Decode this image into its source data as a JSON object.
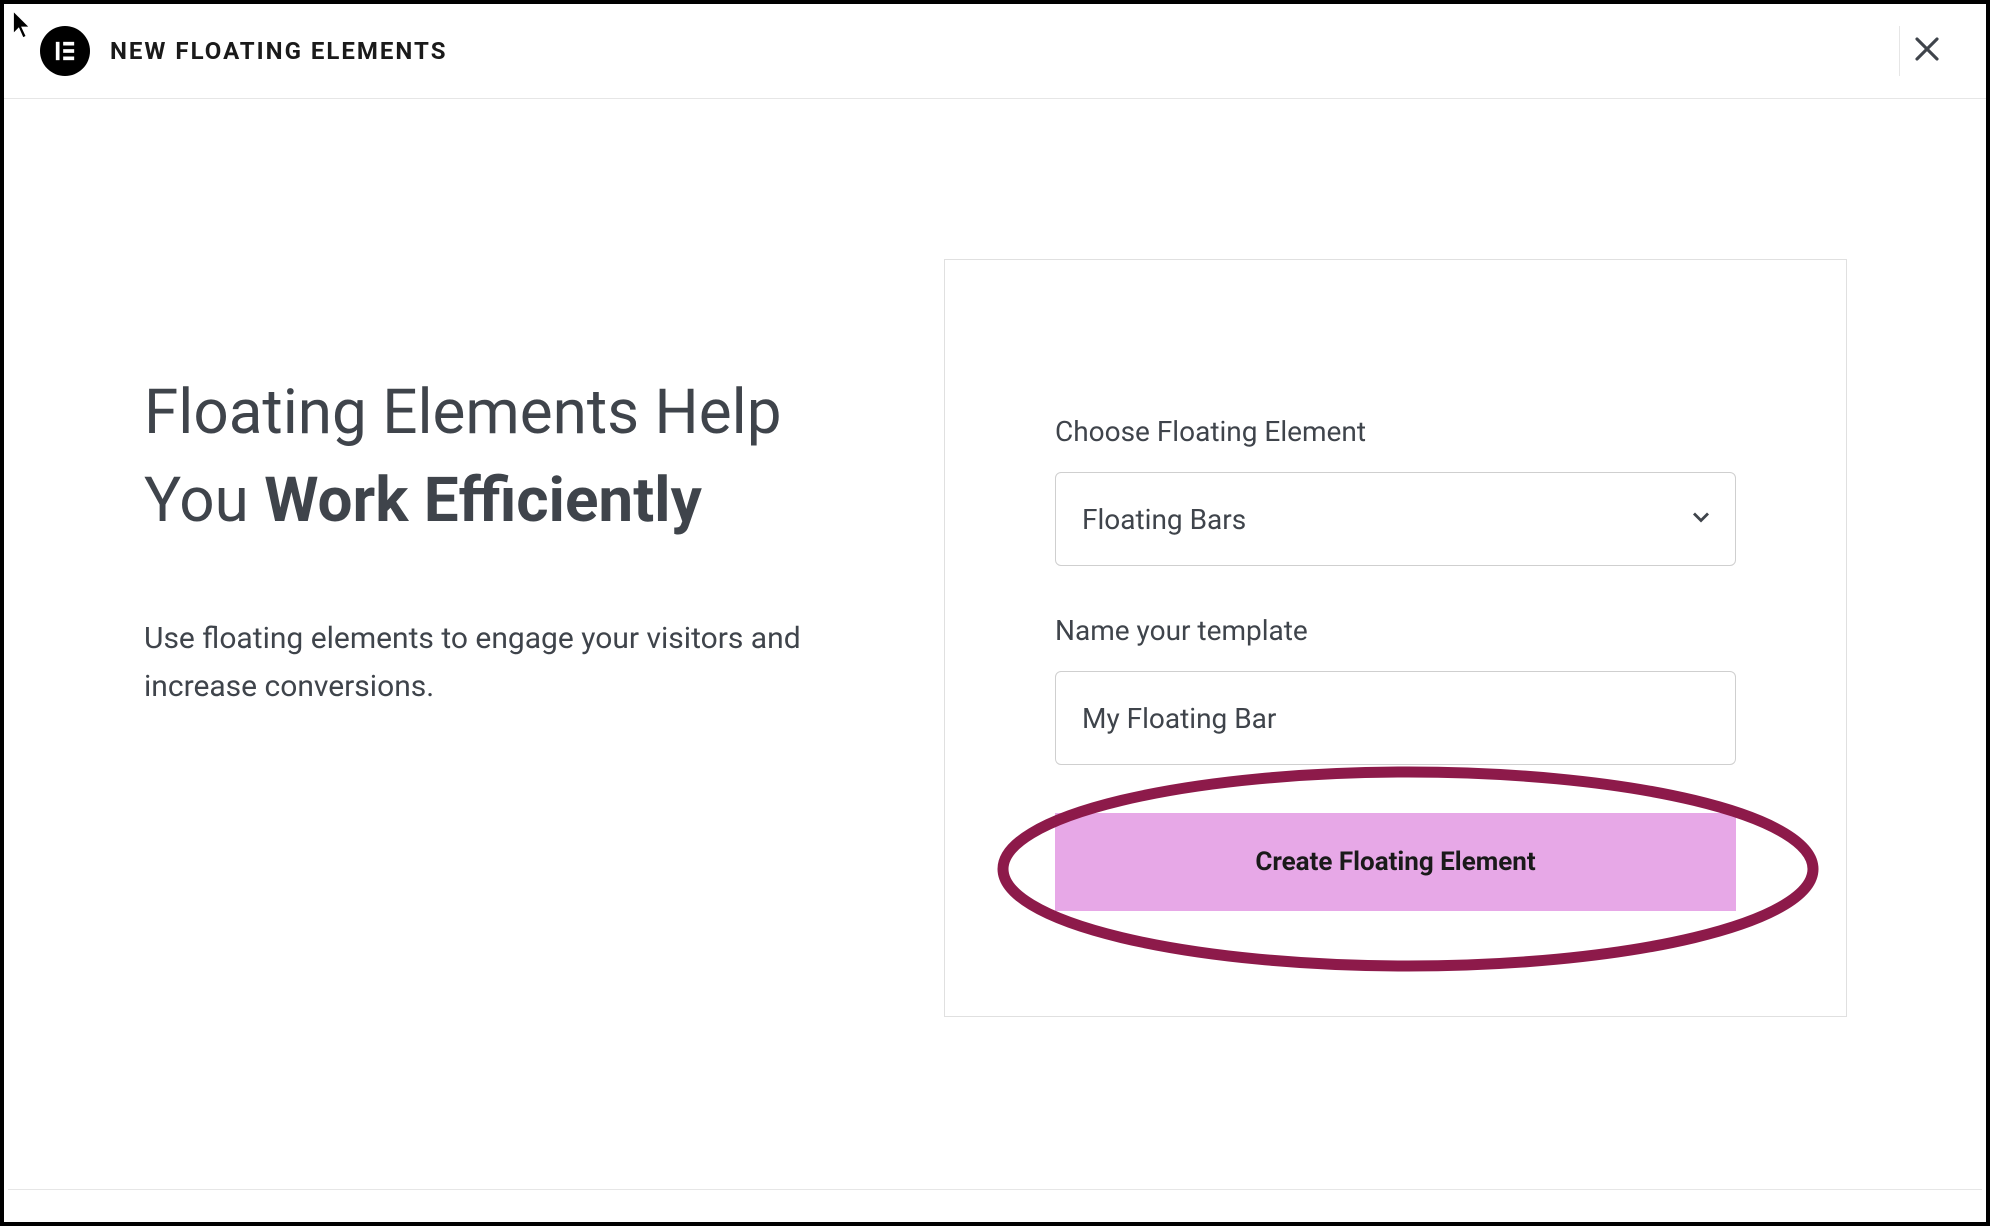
{
  "header": {
    "logo_text": "E",
    "title": "NEW FLOATING ELEMENTS"
  },
  "left": {
    "headline_part1": "Floating Elements Help You ",
    "headline_bold": "Work Efficiently",
    "subtext": "Use floating elements to engage your visitors and increase conversions."
  },
  "form": {
    "choose_label": "Choose Floating Element",
    "choose_value": "Floating Bars",
    "name_label": "Name your template",
    "name_value": "My Floating Bar",
    "create_label": "Create Floating Element"
  },
  "annotation": {
    "highlight_color": "#8d1a4a"
  }
}
